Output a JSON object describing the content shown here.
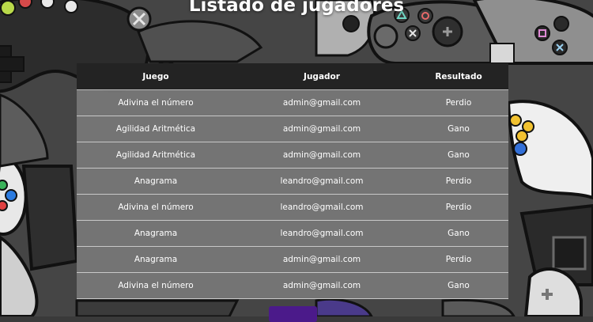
{
  "page": {
    "title": "Listado de jugadores",
    "accent_color": "#4b1a8a"
  },
  "table": {
    "headers": [
      "Juego",
      "Jugador",
      "Resultado"
    ],
    "rows": [
      [
        "Adivina el número",
        "admin@gmail.com",
        "Perdio"
      ],
      [
        "Agilidad Aritmética",
        "admin@gmail.com",
        "Gano"
      ],
      [
        "Agilidad Aritmética",
        "admin@gmail.com",
        "Gano"
      ],
      [
        "Anagrama",
        "leandro@gmail.com",
        "Perdio"
      ],
      [
        "Adivina el número",
        "leandro@gmail.com",
        "Perdio"
      ],
      [
        "Anagrama",
        "leandro@gmail.com",
        "Gano"
      ],
      [
        "Anagrama",
        "admin@gmail.com",
        "Perdio"
      ],
      [
        "Adivina el número",
        "admin@gmail.com",
        "Gano"
      ]
    ]
  },
  "background": {
    "theme": "game-controllers-pattern",
    "icons": [
      "gamepad-icon",
      "xbox-button-icon",
      "dpad-icon",
      "triangle-button-icon",
      "cross-button-icon",
      "circle-button-icon",
      "square-button-icon"
    ]
  }
}
